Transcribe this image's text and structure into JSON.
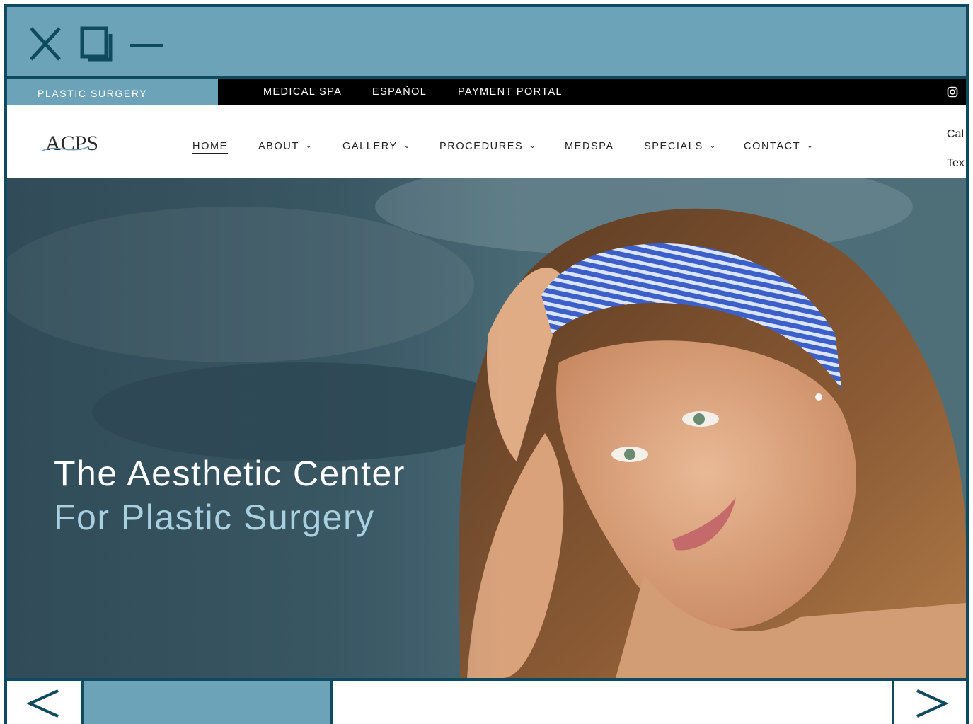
{
  "topbar": {
    "plastic_surgery": "PLASTIC SURGERY",
    "links": [
      "MEDICAL SPA",
      "ESPAÑOL",
      "PAYMENT PORTAL"
    ]
  },
  "nav": {
    "logo_text": "ACPS",
    "items": [
      {
        "label": "HOME",
        "dropdown": false,
        "active": true
      },
      {
        "label": "ABOUT",
        "dropdown": true
      },
      {
        "label": "GALLERY",
        "dropdown": true
      },
      {
        "label": "PROCEDURES",
        "dropdown": true
      },
      {
        "label": "MEDSPA",
        "dropdown": false
      },
      {
        "label": "SPECIALS",
        "dropdown": true
      },
      {
        "label": "CONTACT",
        "dropdown": true
      }
    ],
    "side_call": "Cal",
    "side_text": "Tex"
  },
  "hero": {
    "line1": "The Aesthetic Center",
    "line2": "For Plastic Surgery"
  },
  "colors": {
    "chrome": "#6da3b8",
    "border": "#0f4a5e",
    "topbar": "#000000",
    "hero_subtitle": "#a9d0e0"
  },
  "icons": {
    "close": "close-icon",
    "maximize": "maximize-icon",
    "minimize": "minimize-icon",
    "instagram": "instagram-icon",
    "prev": "chevron-left-icon",
    "next": "chevron-right-icon"
  }
}
